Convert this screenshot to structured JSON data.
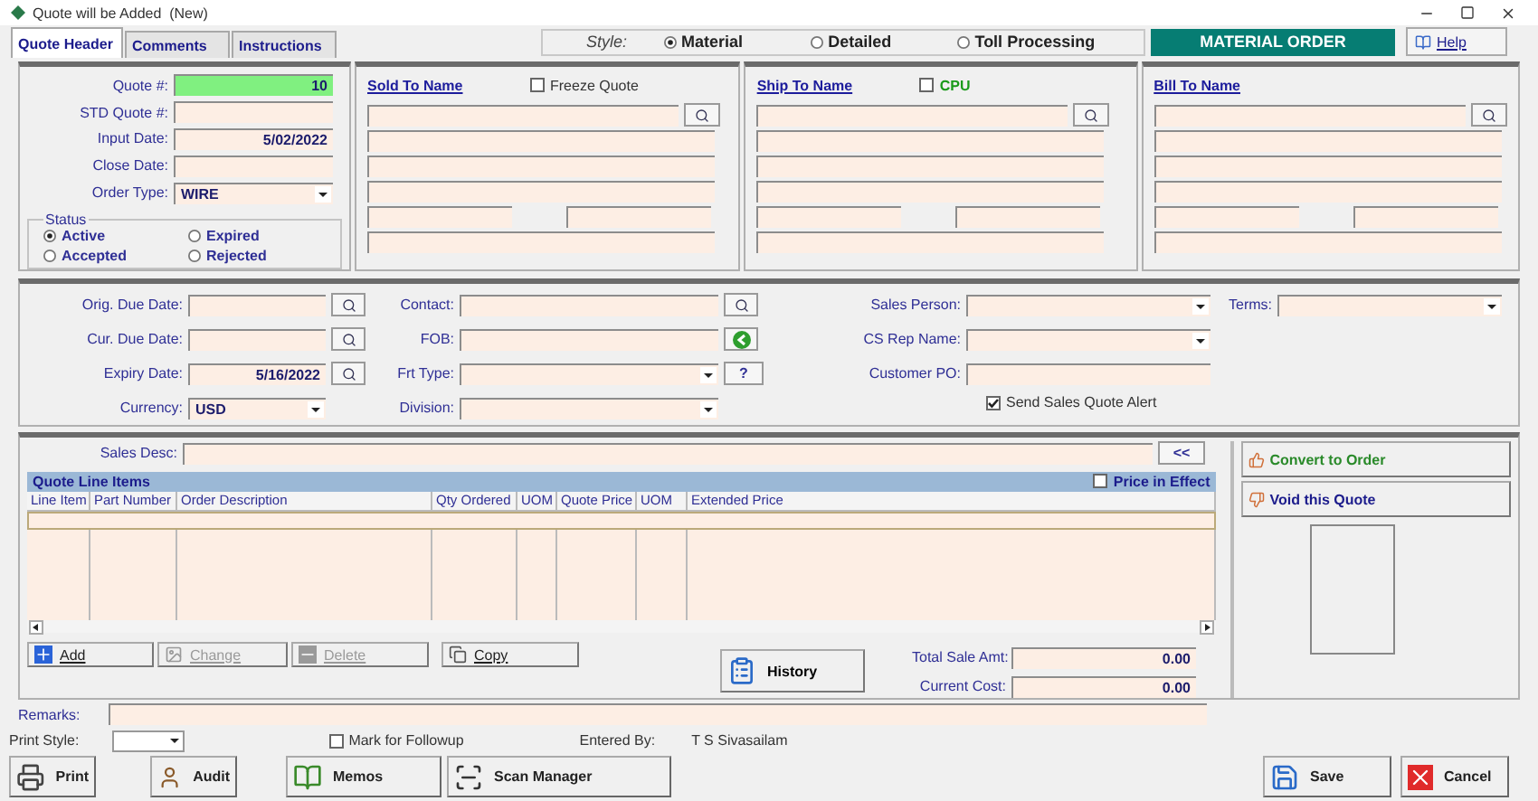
{
  "window": {
    "title": "Quote will be Added  (New)"
  },
  "tabs": [
    {
      "label": "Quote Header",
      "selected": true
    },
    {
      "label": "Comments",
      "selected": false
    },
    {
      "label": "Instructions",
      "selected": false
    }
  ],
  "style": {
    "label": "Style:",
    "options": [
      {
        "label": "Material",
        "selected": true
      },
      {
        "label": "Detailed",
        "selected": false
      },
      {
        "label": "Toll Processing",
        "selected": false
      }
    ]
  },
  "order_banner": "MATERIAL ORDER",
  "help_button": "Help",
  "quote_fields": [
    {
      "label": "Quote #:",
      "value": "10",
      "kind": "highlight"
    },
    {
      "label": "STD Quote #:",
      "kind": "text"
    },
    {
      "label": "Input Date:",
      "value": "5/02/2022",
      "kind": "text"
    },
    {
      "label": "Close Date:",
      "kind": "text"
    },
    {
      "label": "Order Type:",
      "value": "WIRE",
      "kind": "dropdown"
    }
  ],
  "status": {
    "title": "Status",
    "options": [
      {
        "label": "Active",
        "selected": true
      },
      {
        "label": "Expired",
        "selected": false
      },
      {
        "label": "Accepted",
        "selected": false
      },
      {
        "label": "Rejected",
        "selected": false
      }
    ]
  },
  "addresses": [
    {
      "title": "Sold To Name",
      "option": {
        "label": "Freeze Quote",
        "checked": false,
        "kind": "plain"
      }
    },
    {
      "title": "Ship To Name",
      "option": {
        "label": "CPU",
        "checked": false,
        "kind": "green"
      }
    },
    {
      "title": "Bill To Name"
    }
  ],
  "details": {
    "dates": [
      {
        "label": "Orig. Due Date:",
        "kind": "lookup"
      },
      {
        "label": "Cur. Due Date:",
        "kind": "lookup"
      },
      {
        "label": "Expiry Date:",
        "value": "5/16/2022",
        "kind": "lookup"
      },
      {
        "label": "Currency:",
        "value": "USD",
        "kind": "dropdown"
      }
    ],
    "shipping": [
      {
        "label": "Contact:",
        "kind": "lookup"
      },
      {
        "label": "FOB:",
        "kind": "back"
      },
      {
        "label": "Frt Type:",
        "kind": "dropdown",
        "button": "?"
      },
      {
        "label": "Division:",
        "kind": "dropdown"
      }
    ],
    "sales": [
      {
        "label": "Sales Person:",
        "kind": "dropdown"
      },
      {
        "label": "CS Rep Name:",
        "kind": "dropdown"
      },
      {
        "label": "Customer PO:",
        "kind": "text"
      }
    ],
    "alert": {
      "label": "Send Sales Quote Alert",
      "checked": true
    },
    "terms": {
      "label": "Terms:",
      "kind": "dropdown"
    }
  },
  "sales_desc": {
    "label": "Sales Desc:",
    "button": "<<"
  },
  "line_items": {
    "title": "Quote Line Items",
    "price_in_effect": {
      "label": "Price in Effect",
      "checked": false
    },
    "columns": [
      "Line Item",
      "Part Number",
      "Order Description",
      "Qty Ordered",
      "UOM",
      "Quote Price",
      "UOM",
      "Extended Price"
    ]
  },
  "line_actions": [
    {
      "label": "Add",
      "kind": "add",
      "disabled": false
    },
    {
      "label": "Change",
      "kind": "change",
      "disabled": true
    },
    {
      "label": "Delete",
      "kind": "delete",
      "disabled": true
    },
    {
      "label": "Copy",
      "kind": "copy",
      "disabled": false
    }
  ],
  "history_button": "History",
  "totals": [
    {
      "label": "Total Sale Amt:",
      "value": "0.00"
    },
    {
      "label": "Current Cost:",
      "value": "0.00"
    }
  ],
  "side_actions": [
    {
      "label": "Convert to Order",
      "kind": "convert"
    },
    {
      "label": "Void this Quote",
      "kind": "void"
    }
  ],
  "remarks": {
    "label": "Remarks:"
  },
  "footer": {
    "print_style": "Print Style:",
    "followup": {
      "label": "Mark for Followup",
      "checked": false
    },
    "entered_by_label": "Entered By:",
    "entered_by": "T S Sivasailam"
  },
  "buttons": [
    {
      "label": "Print",
      "kind": "print"
    },
    {
      "label": "Audit",
      "kind": "audit"
    },
    {
      "label": "Memos",
      "kind": "memos"
    },
    {
      "label": "Scan Manager",
      "kind": "scan"
    },
    {
      "label": "Save",
      "kind": "save"
    },
    {
      "label": "Cancel",
      "kind": "cancel"
    }
  ]
}
